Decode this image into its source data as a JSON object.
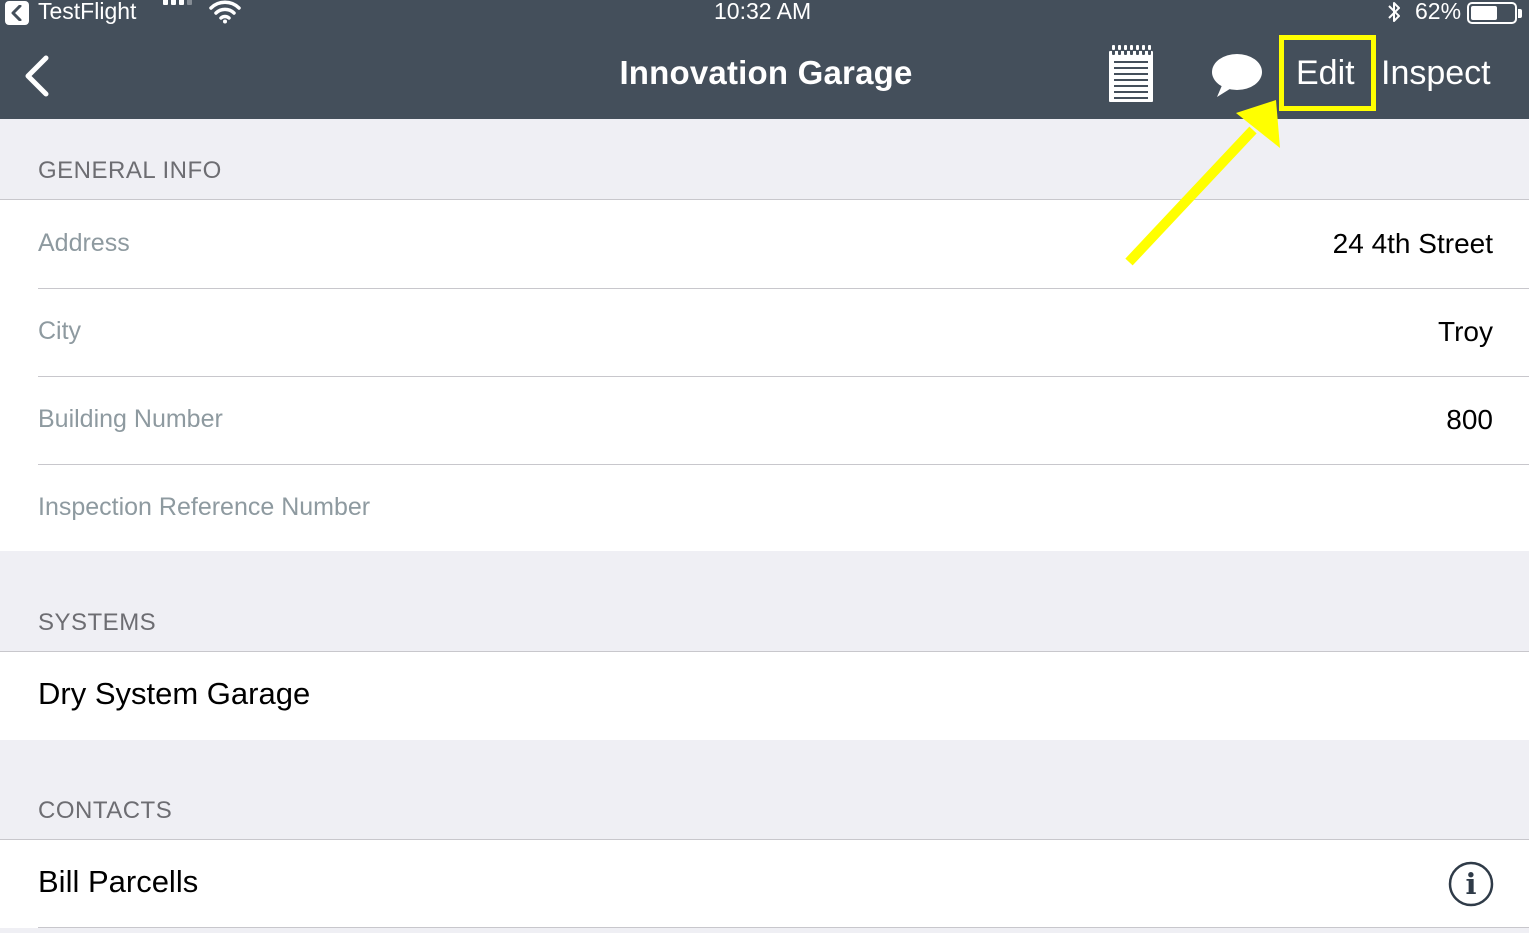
{
  "status_bar": {
    "back_app": "TestFlight",
    "time": "10:32 AM",
    "battery_percent": "62%",
    "battery_level": 0.62,
    "signal_bars": 3,
    "icons": [
      "signal-icon",
      "wifi-icon",
      "bluetooth-icon",
      "battery-icon"
    ]
  },
  "nav": {
    "back_icon": "chevron-left-icon",
    "title": "Innovation Garage",
    "notes_icon": "notepad-icon",
    "comment_icon": "speech-bubble-icon",
    "edit_label": "Edit",
    "inspect_label": "Inspect"
  },
  "annotation": {
    "highlight_color": "#ffff00",
    "target": "edit-button"
  },
  "colors": {
    "nav_background": "#444f5b",
    "page_background": "#efeff4",
    "label_gray": "#8e9aa0",
    "header_gray": "#6d6d72"
  },
  "sections": {
    "general_info": {
      "header": "GENERAL INFO",
      "rows": [
        {
          "label": "Address",
          "value": "24 4th Street"
        },
        {
          "label": "City",
          "value": "Troy"
        },
        {
          "label": "Building Number",
          "value": "800"
        },
        {
          "label": "Inspection Reference Number",
          "value": ""
        }
      ]
    },
    "systems": {
      "header": "SYSTEMS",
      "items": [
        {
          "title": "Dry System Garage"
        }
      ]
    },
    "contacts": {
      "header": "CONTACTS",
      "items": [
        {
          "title": "Bill Parcells",
          "icon": "info-icon"
        }
      ]
    }
  }
}
